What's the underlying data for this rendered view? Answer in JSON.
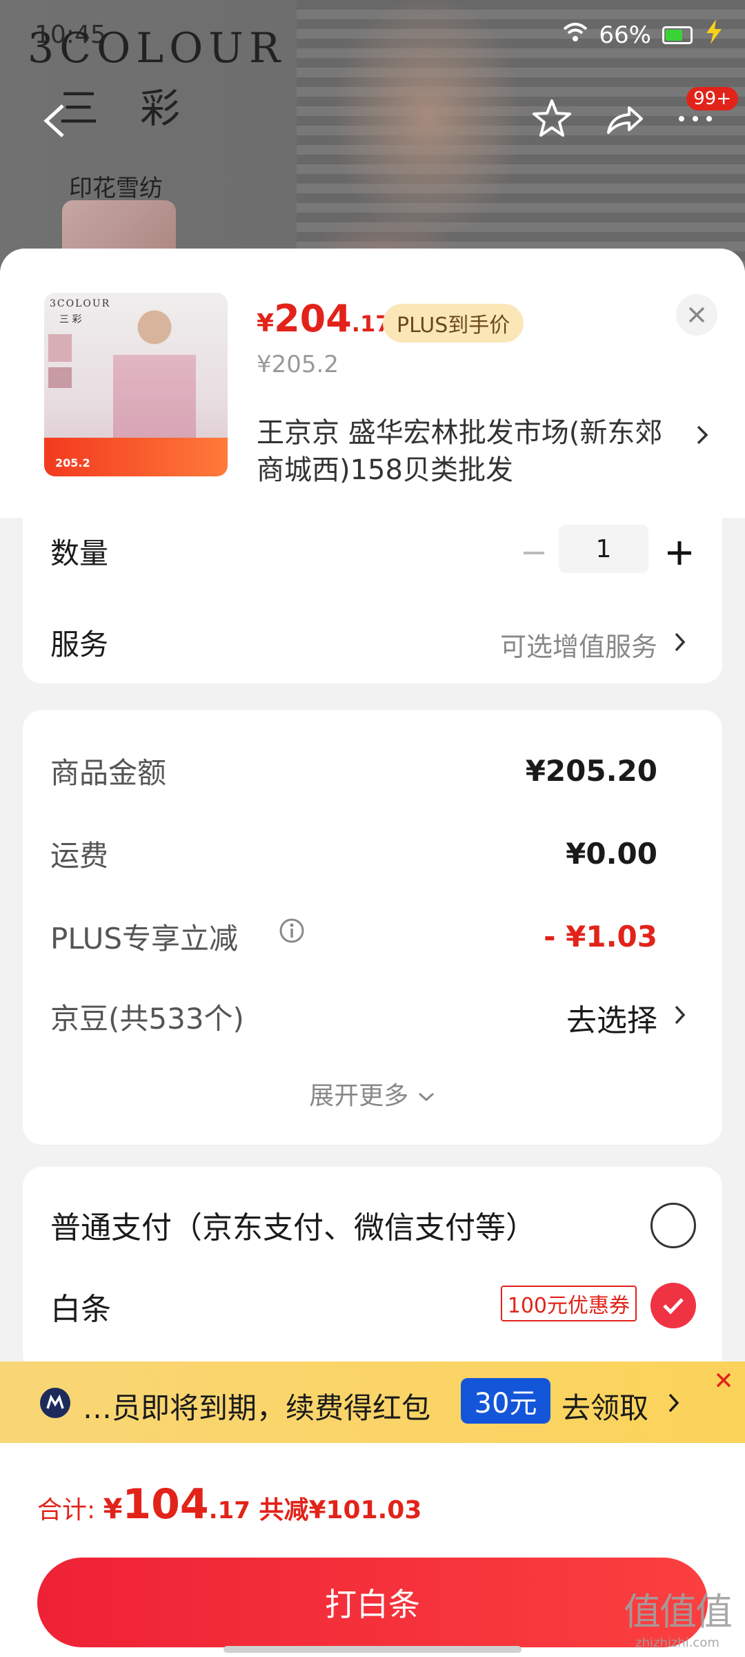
{
  "status_bar": {
    "time": "10:45",
    "battery": "66%"
  },
  "header": {
    "brand_en": "3COLOUR",
    "brand_cn": "三彩",
    "print_label": "印花雪纺",
    "badge": "99+"
  },
  "product": {
    "price_currency": "¥",
    "price_int": "204",
    "price_dec": ".17",
    "plus_tag": "PLUS到手价",
    "original_price": "¥205.2",
    "thumb_promo_price": "205.2",
    "thumb_brand_en": "3COLOUR",
    "thumb_brand_cn": "三 彩",
    "address": "王京京  盛华宏林批发市场(新东郊商城西)158贝类批发"
  },
  "quantity": {
    "label": "数量",
    "value": "1"
  },
  "service": {
    "label": "服务",
    "value": "可选增值服务"
  },
  "breakdown": {
    "items": [
      {
        "label": "商品金额",
        "value": "¥205.20"
      },
      {
        "label": "运费",
        "value": "¥0.00"
      },
      {
        "label": "PLUS专享立减",
        "value": "- ¥1.03"
      }
    ],
    "beans_label": "京豆(共533个)",
    "beans_action": "去选择",
    "expand": "展开更多"
  },
  "payment": {
    "normal_label": "普通支付（京东支付、微信支付等）",
    "baitiao_label": "白条",
    "coupon": "100元优惠券"
  },
  "banner": {
    "text": "…员即将到期，续费得红包",
    "amount": "30元",
    "cta": "去领取"
  },
  "footer": {
    "total_label": "合计: ",
    "currency": "¥",
    "total_int": "104",
    "total_dec": ".17",
    "saved": " 共减¥101.03",
    "button": "打白条"
  },
  "watermark": {
    "main": "值值值",
    "sub": "zhizhizhi.com"
  },
  "colors": {
    "accent": "#e2231a",
    "cta": "#ee2236",
    "banner": "#f9d676",
    "plus_tag": "#fbe6b8"
  }
}
